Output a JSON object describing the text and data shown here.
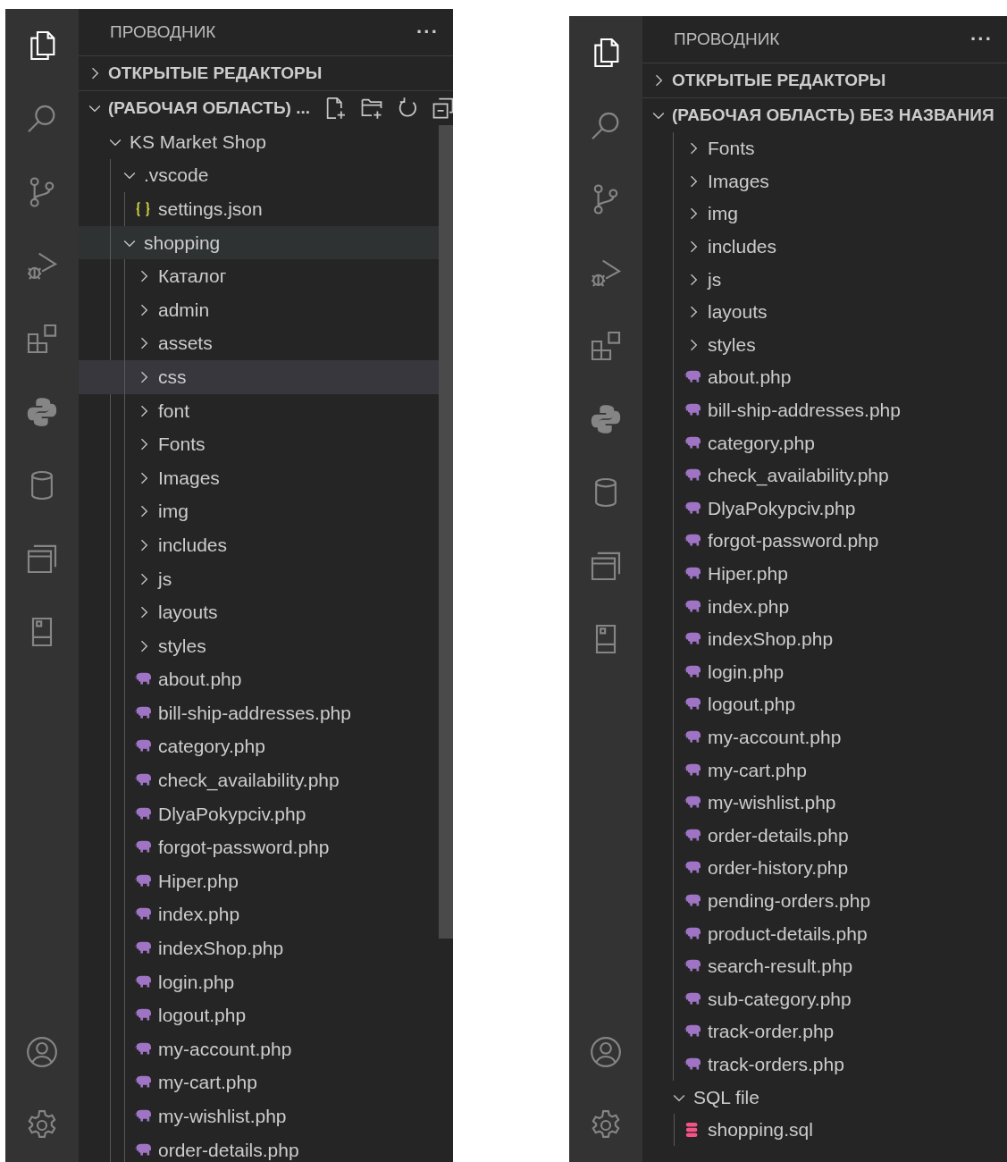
{
  "panels": [
    {
      "activity": [
        {
          "kind": "explorer",
          "selected": true
        },
        {
          "kind": "search",
          "selected": false
        },
        {
          "kind": "source-control",
          "selected": false
        },
        {
          "kind": "run-debug",
          "selected": false
        },
        {
          "kind": "extensions",
          "selected": false
        },
        {
          "kind": "python",
          "selected": false
        },
        {
          "kind": "database",
          "selected": false
        },
        {
          "kind": "windows",
          "selected": false
        },
        {
          "kind": "device",
          "selected": false
        }
      ],
      "activity_bottom": [
        {
          "kind": "account"
        },
        {
          "kind": "settings"
        }
      ],
      "title": "ПРОВОДНИК",
      "more": "···",
      "open_editors": {
        "label": "ОТКРЫТЫЕ РЕДАКТОРЫ",
        "expanded": false
      },
      "workspace": {
        "label": "(РАБОЧАЯ ОБЛАСТЬ) ...",
        "expanded": true,
        "actions": [
          {
            "kind": "new-file"
          },
          {
            "kind": "new-folder"
          },
          {
            "kind": "refresh"
          },
          {
            "kind": "collapse"
          }
        ]
      },
      "scrollbar_visible": true,
      "tree": [
        {
          "label": "KS Market Shop",
          "kind": "folder",
          "expanded": true,
          "selected": false,
          "hovered": false,
          "children": [
            {
              "label": ".vscode",
              "kind": "folder",
              "expanded": true,
              "selected": false,
              "hovered": false,
              "children": [
                {
                  "label": "settings.json",
                  "kind": "json",
                  "selected": false,
                  "hovered": false
                }
              ]
            },
            {
              "label": "shopping",
              "kind": "folder",
              "expanded": true,
              "selected": false,
              "hovered": true,
              "children": [
                {
                  "label": "Каталог",
                  "kind": "folder",
                  "expanded": false,
                  "selected": false,
                  "hovered": false
                },
                {
                  "label": "admin",
                  "kind": "folder",
                  "expanded": false,
                  "selected": false,
                  "hovered": false
                },
                {
                  "label": "assets",
                  "kind": "folder",
                  "expanded": false,
                  "selected": false,
                  "hovered": false
                },
                {
                  "label": "css",
                  "kind": "folder",
                  "expanded": false,
                  "selected": true,
                  "hovered": false
                },
                {
                  "label": "font",
                  "kind": "folder",
                  "expanded": false,
                  "selected": false,
                  "hovered": false
                },
                {
                  "label": "Fonts",
                  "kind": "folder",
                  "expanded": false,
                  "selected": false,
                  "hovered": false
                },
                {
                  "label": "Images",
                  "kind": "folder",
                  "expanded": false,
                  "selected": false,
                  "hovered": false
                },
                {
                  "label": "img",
                  "kind": "folder",
                  "expanded": false,
                  "selected": false,
                  "hovered": false
                },
                {
                  "label": "includes",
                  "kind": "folder",
                  "expanded": false,
                  "selected": false,
                  "hovered": false
                },
                {
                  "label": "js",
                  "kind": "folder",
                  "expanded": false,
                  "selected": false,
                  "hovered": false
                },
                {
                  "label": "layouts",
                  "kind": "folder",
                  "expanded": false,
                  "selected": false,
                  "hovered": false
                },
                {
                  "label": "styles",
                  "kind": "folder",
                  "expanded": false,
                  "selected": false,
                  "hovered": false
                },
                {
                  "label": "about.php",
                  "kind": "php",
                  "selected": false,
                  "hovered": false
                },
                {
                  "label": "bill-ship-addresses.php",
                  "kind": "php",
                  "selected": false,
                  "hovered": false
                },
                {
                  "label": "category.php",
                  "kind": "php",
                  "selected": false,
                  "hovered": false
                },
                {
                  "label": "check_availability.php",
                  "kind": "php",
                  "selected": false,
                  "hovered": false
                },
                {
                  "label": "DlyaPokypciv.php",
                  "kind": "php",
                  "selected": false,
                  "hovered": false
                },
                {
                  "label": "forgot-password.php",
                  "kind": "php",
                  "selected": false,
                  "hovered": false
                },
                {
                  "label": "Hiper.php",
                  "kind": "php",
                  "selected": false,
                  "hovered": false
                },
                {
                  "label": "index.php",
                  "kind": "php",
                  "selected": false,
                  "hovered": false
                },
                {
                  "label": "indexShop.php",
                  "kind": "php",
                  "selected": false,
                  "hovered": false
                },
                {
                  "label": "login.php",
                  "kind": "php",
                  "selected": false,
                  "hovered": false
                },
                {
                  "label": "logout.php",
                  "kind": "php",
                  "selected": false,
                  "hovered": false
                },
                {
                  "label": "my-account.php",
                  "kind": "php",
                  "selected": false,
                  "hovered": false
                },
                {
                  "label": "my-cart.php",
                  "kind": "php",
                  "selected": false,
                  "hovered": false
                },
                {
                  "label": "my-wishlist.php",
                  "kind": "php",
                  "selected": false,
                  "hovered": false
                },
                {
                  "label": "order-details.php",
                  "kind": "php",
                  "selected": false,
                  "hovered": false
                }
              ]
            }
          ]
        }
      ]
    },
    {
      "activity": [
        {
          "kind": "explorer",
          "selected": true
        },
        {
          "kind": "search",
          "selected": false
        },
        {
          "kind": "source-control",
          "selected": false
        },
        {
          "kind": "run-debug",
          "selected": false
        },
        {
          "kind": "extensions",
          "selected": false
        },
        {
          "kind": "python",
          "selected": false
        },
        {
          "kind": "database",
          "selected": false
        },
        {
          "kind": "windows",
          "selected": false
        },
        {
          "kind": "device",
          "selected": false
        }
      ],
      "activity_bottom": [
        {
          "kind": "account"
        },
        {
          "kind": "settings"
        }
      ],
      "title": "ПРОВОДНИК",
      "more": "···",
      "open_editors": {
        "label": "ОТКРЫТЫЕ РЕДАКТОРЫ",
        "expanded": false
      },
      "workspace": {
        "label": "(РАБОЧАЯ ОБЛАСТЬ) БЕЗ НАЗВАНИЯ",
        "expanded": true
      },
      "scrollbar_visible": false,
      "tree": [
        {
          "kind": "continued",
          "children": [
            {
              "label": "Fonts",
              "kind": "folder",
              "expanded": false,
              "selected": false,
              "hovered": false
            },
            {
              "label": "Images",
              "kind": "folder",
              "expanded": false,
              "selected": false,
              "hovered": false
            },
            {
              "label": "img",
              "kind": "folder",
              "expanded": false,
              "selected": false,
              "hovered": false
            },
            {
              "label": "includes",
              "kind": "folder",
              "expanded": false,
              "selected": false,
              "hovered": false
            },
            {
              "label": "js",
              "kind": "folder",
              "expanded": false,
              "selected": false,
              "hovered": false
            },
            {
              "label": "layouts",
              "kind": "folder",
              "expanded": false,
              "selected": false,
              "hovered": false
            },
            {
              "label": "styles",
              "kind": "folder",
              "expanded": false,
              "selected": false,
              "hovered": false
            },
            {
              "label": "about.php",
              "kind": "php",
              "selected": false,
              "hovered": false
            },
            {
              "label": "bill-ship-addresses.php",
              "kind": "php",
              "selected": false,
              "hovered": false
            },
            {
              "label": "category.php",
              "kind": "php",
              "selected": false,
              "hovered": false
            },
            {
              "label": "check_availability.php",
              "kind": "php",
              "selected": false,
              "hovered": false
            },
            {
              "label": "DlyaPokypciv.php",
              "kind": "php",
              "selected": false,
              "hovered": false
            },
            {
              "label": "forgot-password.php",
              "kind": "php",
              "selected": false,
              "hovered": false
            },
            {
              "label": "Hiper.php",
              "kind": "php",
              "selected": false,
              "hovered": false
            },
            {
              "label": "index.php",
              "kind": "php",
              "selected": false,
              "hovered": false
            },
            {
              "label": "indexShop.php",
              "kind": "php",
              "selected": false,
              "hovered": false
            },
            {
              "label": "login.php",
              "kind": "php",
              "selected": false,
              "hovered": false
            },
            {
              "label": "logout.php",
              "kind": "php",
              "selected": false,
              "hovered": false
            },
            {
              "label": "my-account.php",
              "kind": "php",
              "selected": false,
              "hovered": false
            },
            {
              "label": "my-cart.php",
              "kind": "php",
              "selected": false,
              "hovered": false
            },
            {
              "label": "my-wishlist.php",
              "kind": "php",
              "selected": false,
              "hovered": false
            },
            {
              "label": "order-details.php",
              "kind": "php",
              "selected": false,
              "hovered": false
            },
            {
              "label": "order-history.php",
              "kind": "php",
              "selected": false,
              "hovered": false
            },
            {
              "label": "pending-orders.php",
              "kind": "php",
              "selected": false,
              "hovered": false
            },
            {
              "label": "product-details.php",
              "kind": "php",
              "selected": false,
              "hovered": false
            },
            {
              "label": "search-result.php",
              "kind": "php",
              "selected": false,
              "hovered": false
            },
            {
              "label": "sub-category.php",
              "kind": "php",
              "selected": false,
              "hovered": false
            },
            {
              "label": "track-order.php",
              "kind": "php",
              "selected": false,
              "hovered": false
            },
            {
              "label": "track-orders.php",
              "kind": "php",
              "selected": false,
              "hovered": false
            }
          ]
        },
        {
          "label": "SQL file",
          "kind": "folder",
          "expanded": true,
          "selected": false,
          "hovered": false,
          "children": [
            {
              "label": "shopping.sql",
              "kind": "sql",
              "selected": false,
              "hovered": false
            }
          ]
        }
      ]
    }
  ]
}
